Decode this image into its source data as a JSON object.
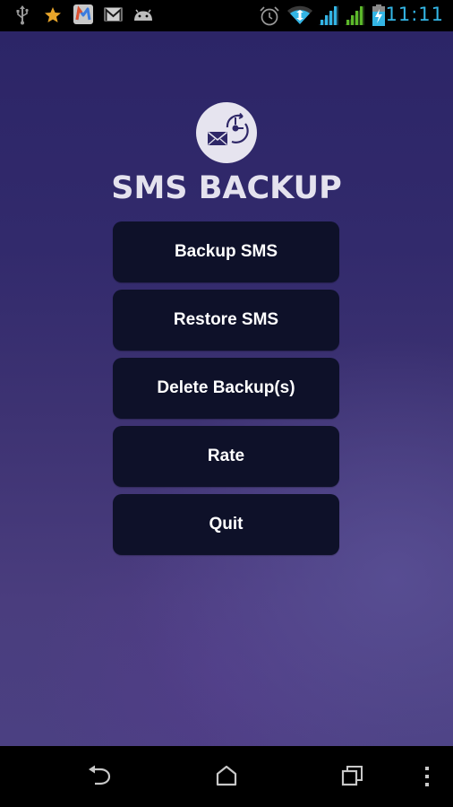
{
  "status_bar": {
    "left_icons": [
      "usb-icon",
      "star-icon",
      "mail-app-icon",
      "gmail-icon",
      "android-icon"
    ],
    "right_icons": [
      "alarm-icon",
      "wifi-icon",
      "signal-icon",
      "signal-icon-2",
      "battery-charging-icon"
    ],
    "time": "11:11",
    "colors": {
      "accent": "#33b5e5",
      "signal_secondary": "#5cb82a"
    }
  },
  "app": {
    "logo_icon": "sms-backup-logo-icon",
    "title": "SMS BACKUP",
    "menu": [
      {
        "id": "backup",
        "label": "Backup SMS"
      },
      {
        "id": "restore",
        "label": "Restore SMS"
      },
      {
        "id": "delete",
        "label": "Delete Backup(s)"
      },
      {
        "id": "rate",
        "label": "Rate"
      },
      {
        "id": "quit",
        "label": "Quit"
      }
    ],
    "colors": {
      "background_top": "#2c2567",
      "background_bottom": "#4b4082",
      "button_bg": "#0e1129",
      "button_text": "#ffffff",
      "title_text": "#e4e2ee"
    }
  },
  "nav_bar": {
    "buttons": [
      "back-icon",
      "home-icon",
      "recents-icon",
      "overflow-menu-icon"
    ]
  }
}
